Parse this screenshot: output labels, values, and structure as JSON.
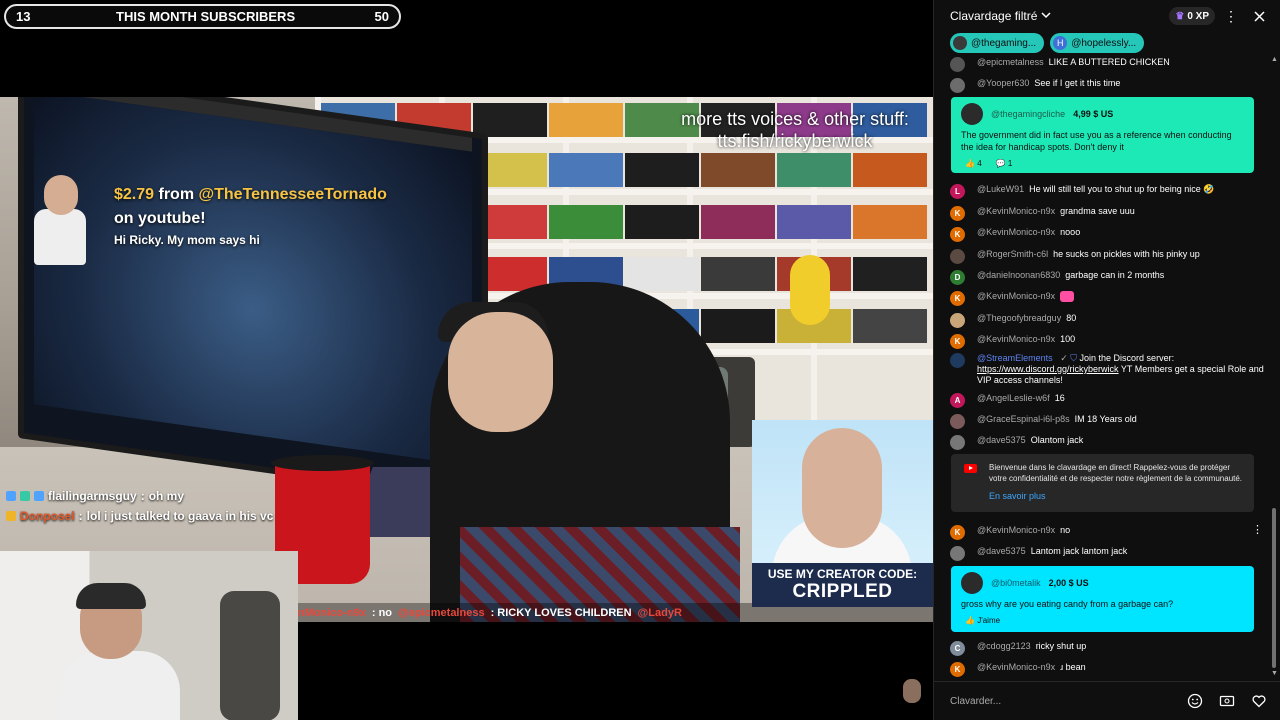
{
  "overlay": {
    "sub_bar": {
      "left_count": "13",
      "title": "THIS MONTH SUBSCRIBERS",
      "right_count": "50"
    },
    "tts_note": "more tts voices & other stuff: tts.fish/rickyberwick",
    "donation": {
      "amount": "$2.79",
      "from": "from",
      "user": "@TheTennesseeTornado",
      "platform": "on youtube!",
      "message": "Hi Ricky. My mom says hi"
    },
    "overlay_chat": [
      {
        "name": "flailingarmsguy",
        "sep": ":",
        "text": "oh my"
      },
      {
        "name": "Donposel",
        "sep": ":",
        "text": "lol i just talked to gaava in his vc"
      }
    ],
    "ticker": [
      {
        "name": "nMonico-n9x",
        "text": ": no"
      },
      {
        "name": "@epicmetalness",
        "text": ": RICKY LOVES CHILDREN"
      },
      {
        "name": "@LadyR",
        "text": ""
      }
    ],
    "creator_code": {
      "line1": "USE MY CREATOR CODE:",
      "line2": "CRIPPLED"
    }
  },
  "chat": {
    "header": {
      "mode_label": "Clavardage filtré",
      "xp": "0 XP"
    },
    "pinned": [
      {
        "label": "@thegaming..."
      },
      {
        "initial": "H",
        "label": "@hopelessly..."
      }
    ],
    "messages_top": [
      {
        "author": "@epicmetalness",
        "text": "LIKE A BUTTERED CHICKEN",
        "color": "#555555",
        "initial": ""
      },
      {
        "author": "@Yooper630",
        "text": "See if I get it this time",
        "color": "#6c6c6c",
        "initial": ""
      }
    ],
    "superchat1": {
      "author": "@thegamingcliche",
      "amount": "4,99 $ US",
      "text": "The government did in fact use you as a reference when conducting the idea for handicap spots. Don't deny it",
      "likes": "4",
      "replies": "1"
    },
    "messages_mid": [
      {
        "author": "@LukeW91",
        "text": "He will still tell you to shut up for being nice 🤣",
        "color": "#c2185b",
        "initial": "L"
      },
      {
        "author": "@KevinMonico-n9x",
        "text": "grandma save uuu",
        "color": "#e06c00",
        "initial": "K"
      },
      {
        "author": "@KevinMonico-n9x",
        "text": "nooo",
        "color": "#e06c00",
        "initial": "K"
      },
      {
        "author": "@RogerSmith-c6l",
        "text": "he sucks on pickles with his pinky up",
        "color": "#5a4a42",
        "initial": ""
      },
      {
        "author": "@danielnoonan6830",
        "text": "garbage can in 2 months",
        "color": "#2e7d32",
        "initial": "D"
      },
      {
        "author": "@KevinMonico-n9x",
        "text": "",
        "color": "#e06c00",
        "initial": "K",
        "emoji_color": "#ff4fa3"
      },
      {
        "author": "@Thegoofybreadguy",
        "text": "80",
        "color": "#c8a67a",
        "initial": ""
      },
      {
        "author": "@KevinMonico-n9x",
        "text": "100",
        "color": "#e06c00",
        "initial": "K"
      }
    ],
    "stream_elements": {
      "author": "@StreamElements",
      "text_a": "Join the Discord server:",
      "link": "https://www.discord.gg/rickyberwick",
      "text_b": "YT Members get a special Role and VIP access channels!"
    },
    "messages_low": [
      {
        "author": "@AngelLeslie-w6f",
        "text": "16",
        "color": "#c2185b",
        "initial": "A"
      },
      {
        "author": "@GraceEspinal-i6l-p8s",
        "text": "IM 18 Years old",
        "color": "#7a5a5a",
        "initial": ""
      },
      {
        "author": "@dave5375",
        "text": "Olantom jack",
        "color": "#777777",
        "initial": ""
      }
    ],
    "system_notice": {
      "text": "Bienvenue dans le clavardage en direct! Rappelez-vous de protéger votre confidentialité et de respecter notre règlement de la communauté.",
      "link": "En savoir plus"
    },
    "messages_after": [
      {
        "author": "@KevinMonico-n9x",
        "text": "no",
        "color": "#e06c00",
        "initial": "K"
      },
      {
        "author": "@dave5375",
        "text": "Lantom jack lantom jack",
        "color": "#777777",
        "initial": ""
      }
    ],
    "superchat2": {
      "author": "@bi0metalik",
      "amount": "2,00 $ US",
      "text": "gross why are you eating candy from a garbage can?",
      "like_label": "J'aime"
    },
    "messages_bottom": [
      {
        "author": "@cdogg2123",
        "text": "ricky shut up",
        "color": "#7f8c9a",
        "initial": "C"
      },
      {
        "author": "@KevinMonico-n9x",
        "text": "ɹ bean",
        "color": "#e06c00",
        "initial": "K"
      }
    ],
    "input": {
      "placeholder": "Clavarder..."
    }
  },
  "colors": {
    "superchat_green": "#1de9b6",
    "superchat_cyan": "#00e5ff",
    "chat_bg": "#0f0f0f",
    "link_blue": "#3ea6ff"
  },
  "icons": [
    "chevron-down-icon",
    "crown-icon",
    "more-vert-icon",
    "close-icon",
    "thumbs-up-icon",
    "reply-icon",
    "youtube-icon",
    "emoji-icon",
    "superchat-icon",
    "heart-icon"
  ]
}
